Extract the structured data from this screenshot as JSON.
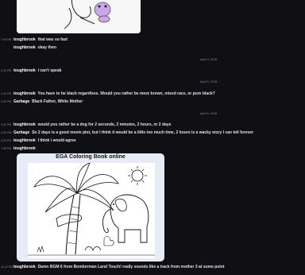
{
  "messages": [
    {
      "time": "7:55 PM",
      "user": "toughbrook",
      "text": "that was so fast"
    },
    {
      "time": "",
      "user": "toughbrook",
      "text": "okay then"
    },
    {
      "date": "April 4, 2016"
    },
    {
      "time": "2:32 PM",
      "user": "toughbrook",
      "text": "i can't speak"
    },
    {
      "date": "April 5, 2016"
    },
    {
      "time": "4:15 PM",
      "user": "toughbrook",
      "text": "You have to be black regardless. Would you rather be more brown, mixed race, or pure black?"
    },
    {
      "time": "4:30 PM",
      "user": "Garbage",
      "text": "Black Father, White Mother"
    },
    {
      "date": "April 6, 2016"
    },
    {
      "time": "4:02 PM",
      "user": "toughbrook",
      "text": "would you rather be a dog for 2 seconds, 2 minutes, 2 hours, or 2 days"
    },
    {
      "time": "4:03 PM",
      "user": "Garbage",
      "text": "So 2 days is a good movie plot, but I think it would be a little too much time, 2 hours is a wacky story I can tell forever"
    },
    {
      "time": "4:03 PM",
      "user": "toughbrook",
      "text": "I think i would agree"
    },
    {
      "time": "7:59 PM",
      "user": "toughbrook",
      "text": ""
    },
    {
      "time": "11:15 PM",
      "user": "toughbrook",
      "text": "Damn BGM 6 from Bomberman Land Touch! really sounds like a track from mother 3 at some point"
    }
  ],
  "attachment": {
    "title": "EGA Coloring Book online"
  }
}
